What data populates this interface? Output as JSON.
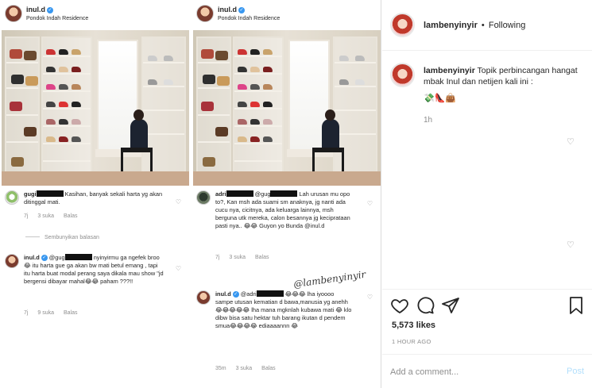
{
  "left_post": {
    "username": "inul.d",
    "location": "Pondok Indah Residence",
    "comments": [
      {
        "user": "gugi",
        "text": "Kasihan, banyak sekali harta yg akan ditinggal mati.",
        "time": "7j",
        "likes": "3 suka",
        "reply": "Balas"
      }
    ],
    "hide_replies": "Sembunyikan balasan",
    "reply": {
      "user": "inul.d",
      "mention": "@gug",
      "text": "nyinyirmu ga ngefek broo😂 itu harta gue ga akan bw mati betul emang , tapi itu harta buat modal perang saya dikala mau show \"jd bergensi dibayar mahal😂😂 paham ???!!",
      "time": "7j",
      "likes": "9 suka",
      "reply_label": "Balas"
    }
  },
  "right_post": {
    "username": "inul.d",
    "location": "Pondok Indah Residence",
    "comment": {
      "user": "adri",
      "mention": "@gug",
      "text": "Lah urusan mu opo to?, Kan msh ada suami sm anaknya, jg nanti ada cucu nya, cicitnya, ada keluarga lainnya, msh berguna utk mereka, calon besannya jg keciprataan pasti nya.. 😂😂 Guyon yo Bunda @inul.d",
      "time": "7j",
      "likes": "3 suka",
      "reply_label": "Balas"
    },
    "reply": {
      "user": "inul.d",
      "mention": "@adri",
      "text": "😂😂😂 lha iyoooo sampe utusan kematian d bawa,manusia yg anehh 😂😂😂😂😂 lha mana mgknlah kubawa mati 😂 klo dibw bisa satu hektar tuh barang ikutan d pendem smua😂😂😂😂 ediaaaannn 😂",
      "time": "35m",
      "likes": "3 suka",
      "reply_label": "Balas"
    },
    "watermark": "@lambenyinyir"
  },
  "sidebar": {
    "username": "lambenyinyir",
    "separator": "•",
    "following": "Following",
    "caption_user": "lambenyinyir",
    "caption_text": "Topik perbincangan hangat mbak Inul dan netijen kali ini :",
    "caption_emojis": "💸👠👜",
    "time_ago": "1h",
    "likes": "5,573 likes",
    "posted": "1 HOUR AGO",
    "comment_placeholder": "Add a comment...",
    "post_label": "Post"
  },
  "colors": {
    "verified": "#3897f0",
    "muted": "#8e8e8e",
    "text": "#262626",
    "post_disabled": "#b2dffc"
  }
}
